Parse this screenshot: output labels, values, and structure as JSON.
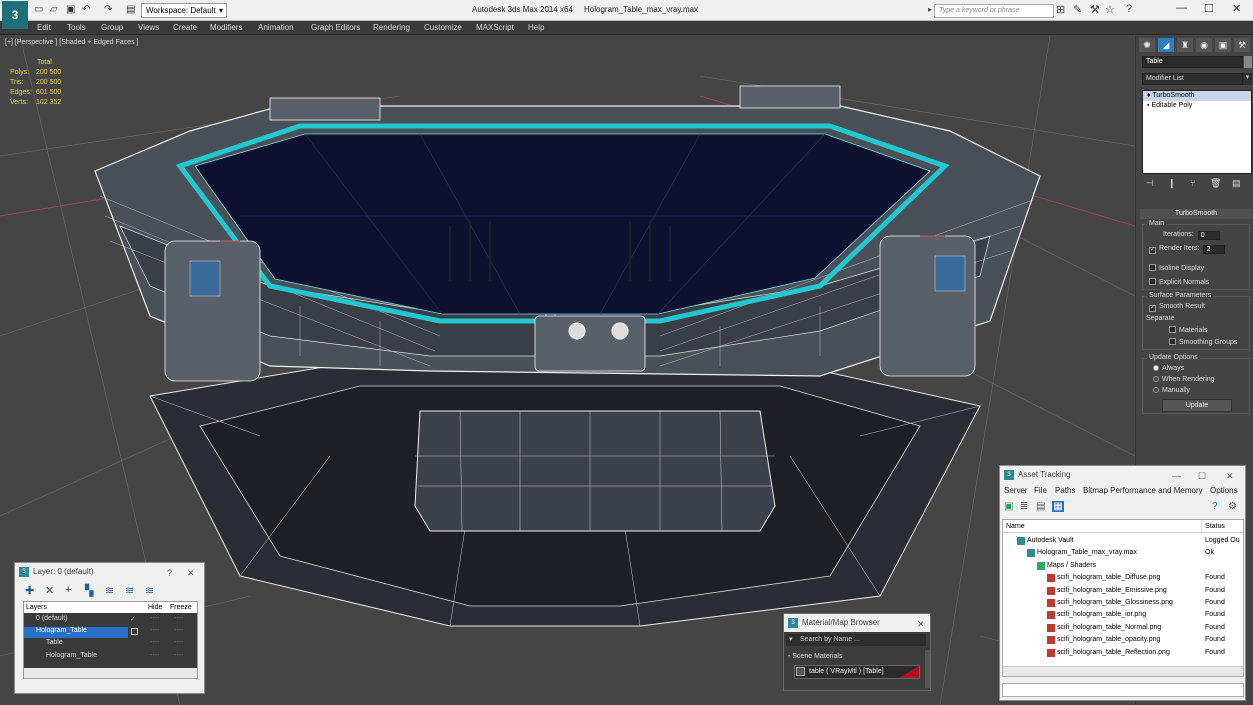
{
  "titlebar": {
    "workspace": "Workspace: Default",
    "app_title": "Autodesk 3ds Max  2014 x64",
    "file_title": "Hologram_Table_max_vray.max",
    "search_placeholder": "Type a keyword or phrase",
    "app_icon": "3ds-max-logo-icon"
  },
  "menu": [
    "Edit",
    "Tools",
    "Group",
    "Views",
    "Create",
    "Modifiers",
    "Animation",
    "Graph Editors",
    "Rendering",
    "Customize",
    "MAXScript",
    "Help"
  ],
  "viewport": {
    "label": "[+] [Perspective ] [Shaded + Edged Faces ]",
    "stats_header": "Total",
    "stats": [
      {
        "label": "Polys:",
        "value": "200 500"
      },
      {
        "label": "Tris:",
        "value": "200 500"
      },
      {
        "label": "Edges:",
        "value": "601 500"
      },
      {
        "label": "Verts:",
        "value": "102 352"
      }
    ]
  },
  "command_panel": {
    "tab_icons": [
      "create-icon",
      "modify-icon",
      "hierarchy-icon",
      "motion-icon",
      "display-icon",
      "utilities-icon"
    ],
    "object_name": "Table",
    "modifier_list": "Modifier List",
    "stack": [
      "TurboSmooth",
      "Editable Poly"
    ],
    "rollout_title": "TurboSmooth",
    "main_group": "Main",
    "iterations_label": "Iterations:",
    "iterations_value": "0",
    "render_iters_label": "Render Iters:",
    "render_iters_value": "2",
    "isoline": "Isoline Display",
    "explicit_normals": "Explicit Normals",
    "surface_group": "Surface Parameters",
    "smooth_result": "Smooth Result",
    "separate": "Separate",
    "materials": "Materials",
    "smoothing_groups": "Smoothing Groups",
    "update_group": "Update Options",
    "always": "Always",
    "when_rendering": "When Rendering",
    "manually": "Manually",
    "update_button": "Update"
  },
  "layer_dialog": {
    "title": "Layer: 0 (default)",
    "col_layers": "Layers",
    "col_hide": "Hide",
    "col_freeze": "Freeze",
    "rows": [
      "0 (default)",
      "Hologram_Table",
      "Table",
      "Hologram_Table"
    ],
    "dash": "----"
  },
  "material_browser": {
    "title": "Material/Map Browser",
    "search_placeholder": "Search by Name ...",
    "section": "- Scene Materials",
    "item": "table  ( VRayMtl ) [Table]"
  },
  "asset_tracking": {
    "title": "Asset Tracking",
    "menu": [
      "Server",
      "File",
      "Paths",
      "Bitmap Performance and Memory",
      "Options"
    ],
    "col_name": "Name",
    "col_status": "Status",
    "rows": [
      {
        "name": "Autodesk Vault",
        "status": "Logged Ou",
        "indent": 0
      },
      {
        "name": "Hologram_Table_max_vray.max",
        "status": "Ok",
        "indent": 1
      },
      {
        "name": "Maps / Shaders",
        "status": "",
        "indent": 2
      },
      {
        "name": "scifi_hologram_table_Diffuse.png",
        "status": "Found",
        "indent": 3
      },
      {
        "name": "scifi_hologram_table_Emissive.png",
        "status": "Found",
        "indent": 3
      },
      {
        "name": "scifi_hologram_table_Glossiness.png",
        "status": "Found",
        "indent": 3
      },
      {
        "name": "scifi_hologram_table_ior.png",
        "status": "Found",
        "indent": 3
      },
      {
        "name": "scifi_hologram_table_Normal.png",
        "status": "Found",
        "indent": 3
      },
      {
        "name": "scifi_hologram_table_opacity.png",
        "status": "Found",
        "indent": 3
      },
      {
        "name": "scifi_hologram_table_Reflection.png",
        "status": "Found",
        "indent": 3
      }
    ]
  },
  "colors": {
    "accent": "#22c8d0",
    "viewport_bg": "#454545",
    "ui_dark": "#444444",
    "stats": "#e8d84a"
  }
}
